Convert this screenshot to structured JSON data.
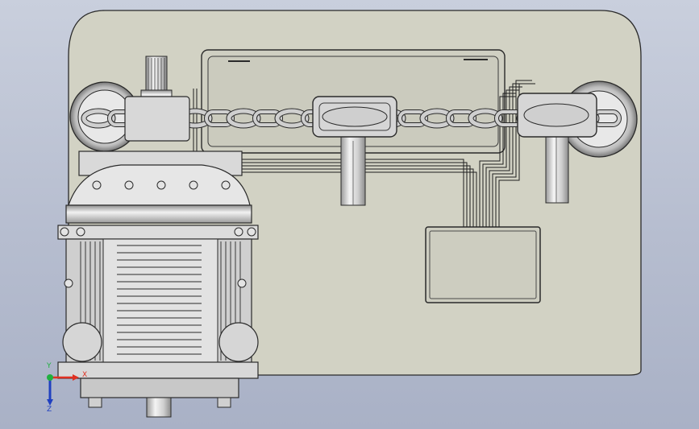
{
  "viewport": {
    "background_top": "#c9cfdd",
    "background_bottom": "#a9b1c6"
  },
  "model": {
    "plate_color": "#d2d2c4",
    "line_color": "#2a2a2a",
    "metal_color": "#dedede",
    "chain_color": "#cfcfcf",
    "cable_color": "#1e1e1e"
  },
  "triad": {
    "x_label": "X",
    "y_label": "Y",
    "z_label": "Z",
    "x_color": "#e03020",
    "y_color": "#20b040",
    "z_color": "#2040c0"
  }
}
